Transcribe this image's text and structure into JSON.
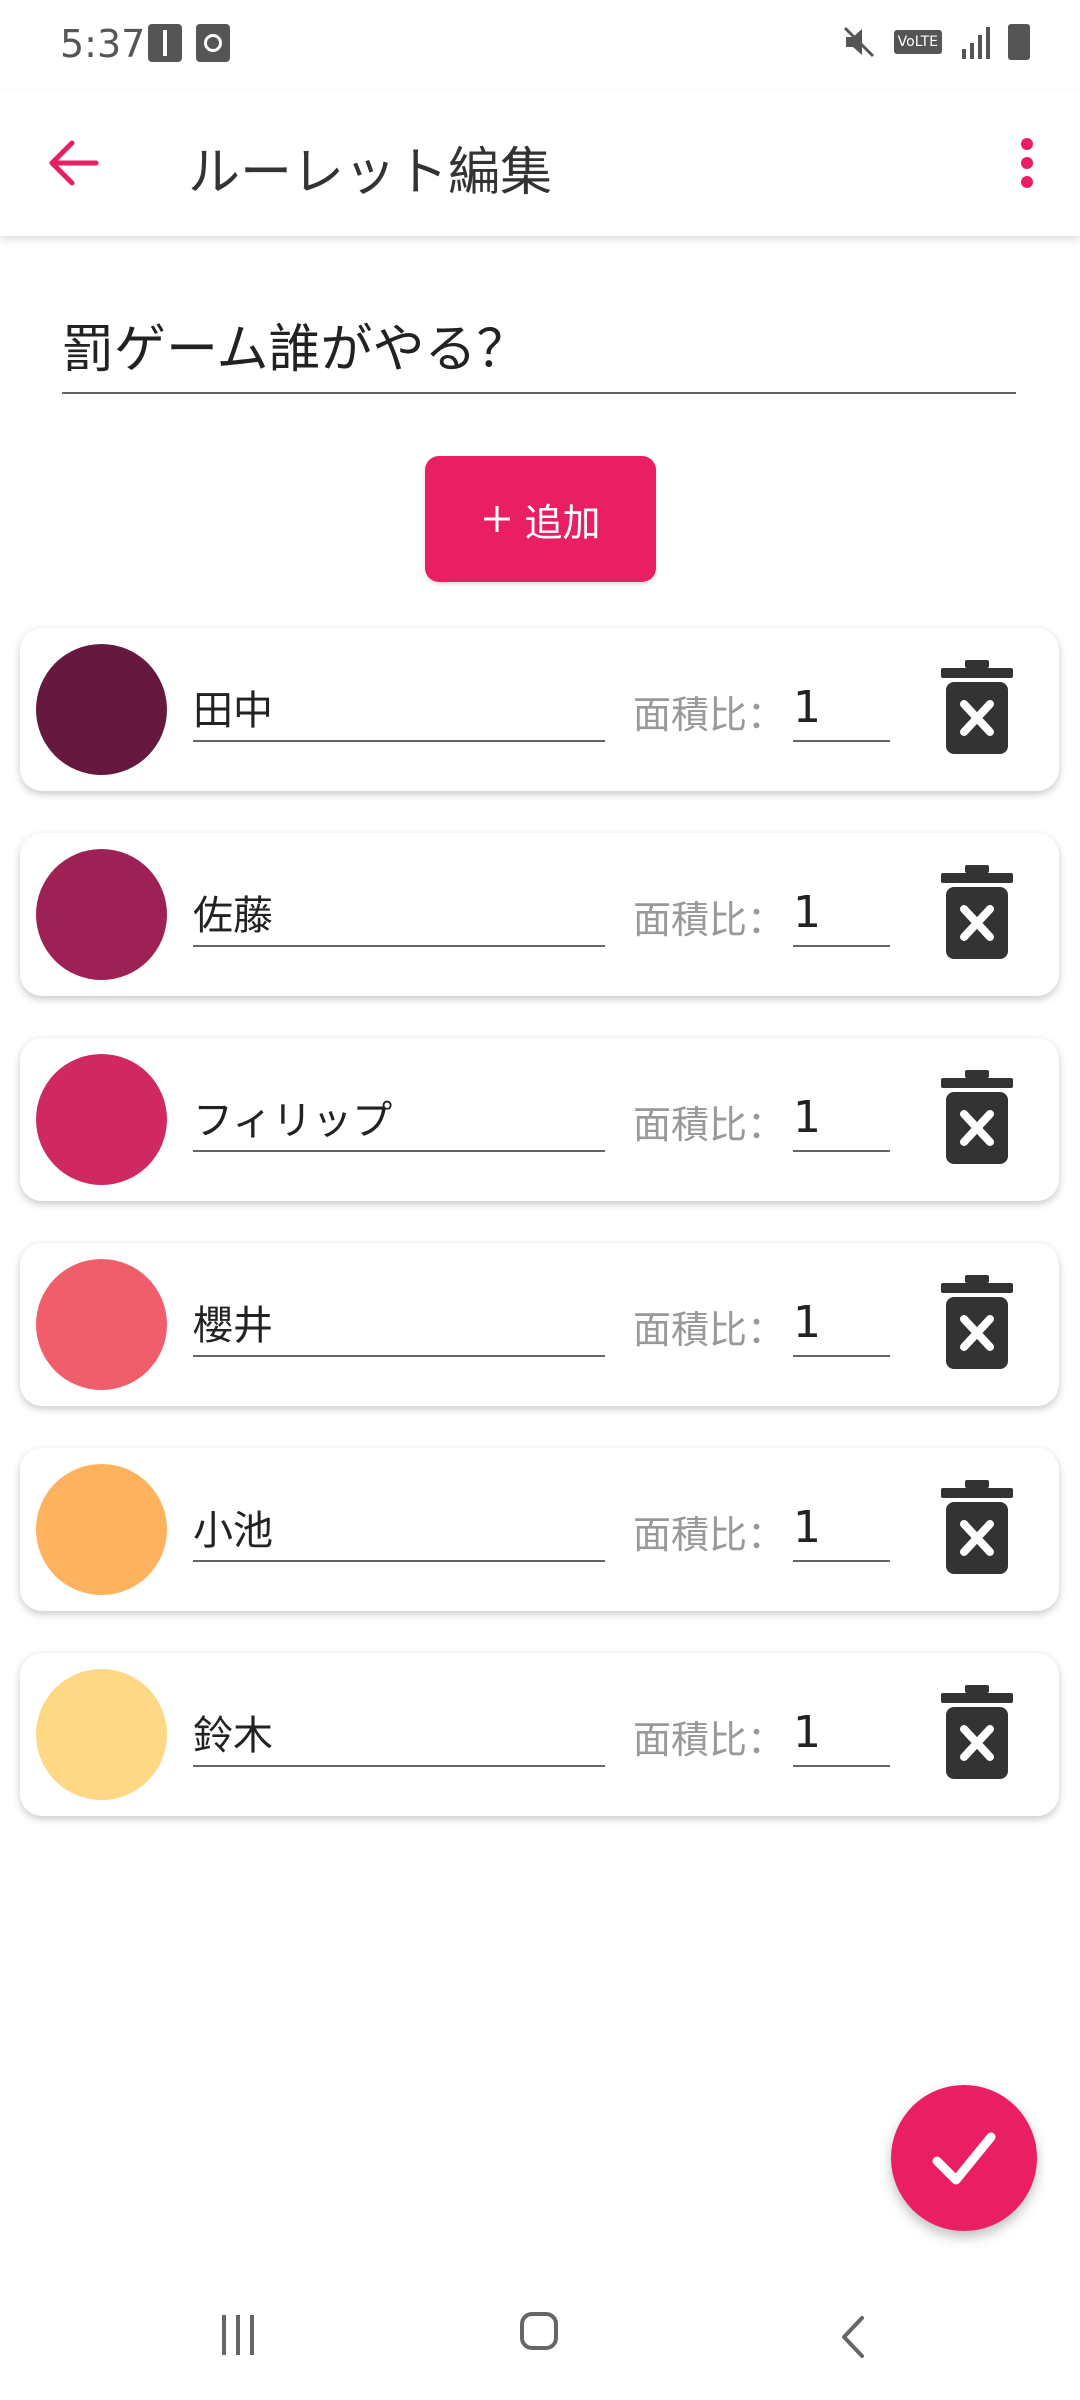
{
  "status_bar": {
    "time": "5:37",
    "volte": "VoLTE"
  },
  "app_bar": {
    "title": "ルーレット編集"
  },
  "roulette_name": "罰ゲーム誰がやる？",
  "add_button": {
    "icon": "plus-icon",
    "label": "追加"
  },
  "items": [
    {
      "name": "田中",
      "ratio_label": "面積比：",
      "ratio": "1",
      "color": "#66193f"
    },
    {
      "name": "佐藤",
      "ratio_label": "面積比：",
      "ratio": "1",
      "color": "#9e2155"
    },
    {
      "name": "フィリップ",
      "ratio_label": "面積比：",
      "ratio": "1",
      "color": "#d02962"
    },
    {
      "name": "櫻井",
      "ratio_label": "面積比：",
      "ratio": "1",
      "color": "#f05e6b"
    },
    {
      "name": "小池",
      "ratio_label": "面積比：",
      "ratio": "1",
      "color": "#ffb25e"
    },
    {
      "name": "鈴木",
      "ratio_label": "面積比：",
      "ratio": "1",
      "color": "#ffd886"
    }
  ],
  "accent_color": "#e91e63"
}
